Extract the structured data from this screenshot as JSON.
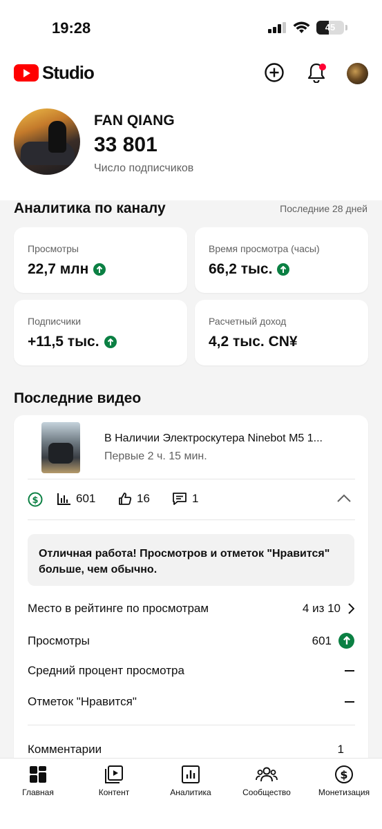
{
  "status_bar": {
    "time": "19:28",
    "battery": "45",
    "battery_level": 0.45
  },
  "header": {
    "app_name": "Studio",
    "brand_color": "#ff0000",
    "notification_color": "#ff0033"
  },
  "channel": {
    "name": "FAN QIANG",
    "subscribers": "33 801",
    "subscribers_label": "Число подписчиков"
  },
  "analytics": {
    "title": "Аналитика по каналу",
    "period": "Последние 28 дней",
    "cards": [
      {
        "label": "Просмотры",
        "value": "22,7 млн",
        "trend": "up"
      },
      {
        "label": "Время просмотра (часы)",
        "value": "66,2 тыс.",
        "trend": "up"
      },
      {
        "label": "Подписчики",
        "value": "+11,5 тыс.",
        "trend": "up"
      },
      {
        "label": "Расчетный доход",
        "value": "4,2 тыс. CN¥",
        "trend": "none"
      }
    ],
    "trend_color": "#0b8043"
  },
  "latest_videos": {
    "title": "Последние видео",
    "video": {
      "title": "В Наличии Электроскутера Ninebot M5 1...",
      "subtitle": "Первые 2 ч. 15 мин.",
      "views": "601",
      "likes": "16",
      "comments": "1"
    },
    "callout": "Отличная работа! Просмотров и отметок \"Нравится\" больше, чем обычно.",
    "rows": [
      {
        "label": "Место в рейтинге по просмотрам",
        "value": "4 из 10"
      },
      {
        "label": "Просмотры",
        "value": "601"
      },
      {
        "label": "Средний процент просмотра",
        "value": ""
      },
      {
        "label": "Отметок \"Нравится\"",
        "value": ""
      },
      {
        "label": "Комментарии",
        "value": "1"
      }
    ]
  },
  "bottom_nav": [
    {
      "label": "Главная",
      "icon": "home-grid-icon"
    },
    {
      "label": "Контент",
      "icon": "content-icon"
    },
    {
      "label": "Аналитика",
      "icon": "analytics-icon"
    },
    {
      "label": "Сообщество",
      "icon": "community-icon"
    },
    {
      "label": "Монетизация",
      "icon": "monetization-icon"
    }
  ]
}
